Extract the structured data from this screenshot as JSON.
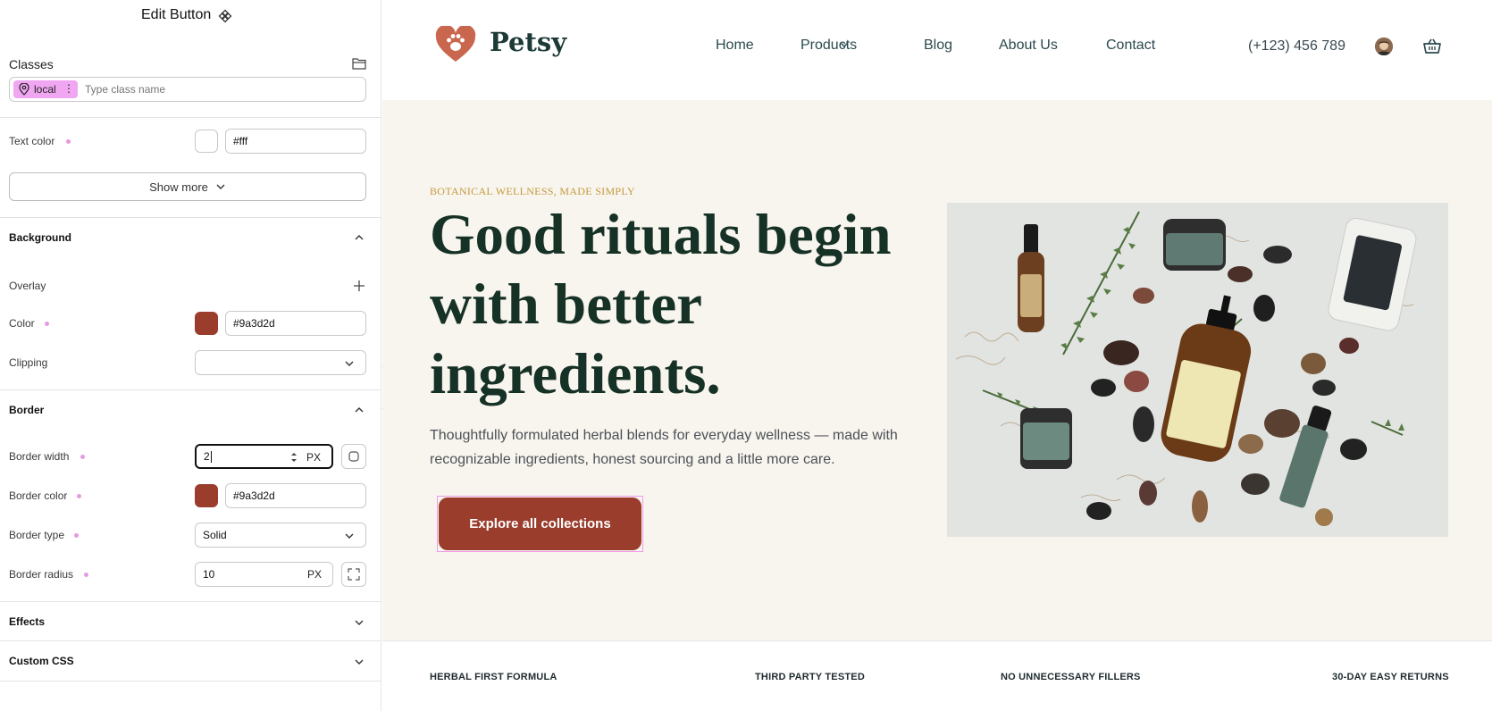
{
  "editor": {
    "title": "Edit Button",
    "classes": {
      "label": "Classes",
      "chip": "local",
      "placeholder": "Type class name"
    },
    "text_color": {
      "label": "Text color",
      "value": "#fff",
      "swatch": "#ffffff"
    },
    "show_more": "Show more",
    "background": {
      "title": "Background",
      "overlay_label": "Overlay",
      "color_label": "Color",
      "color_value": "#9a3d2d",
      "swatch": "#9a3d2d",
      "clipping_label": "Clipping",
      "clipping_value": ""
    },
    "border": {
      "title": "Border",
      "width_label": "Border width",
      "width_value": "2",
      "width_unit": "PX",
      "color_label": "Border color",
      "color_value": "#9a3d2d",
      "swatch": "#9a3d2d",
      "type_label": "Border type",
      "type_value": "Solid",
      "radius_label": "Border radius",
      "radius_value": "10",
      "radius_unit": "PX"
    },
    "effects_title": "Effects",
    "custom_css_title": "Custom CSS"
  },
  "site": {
    "logo": "Petsy",
    "nav": [
      "Home",
      "Products",
      "Blog",
      "About Us",
      "Contact"
    ],
    "phone": "(+123) 456 789",
    "hero": {
      "eyebrow": "BOTANICAL WELLNESS, MADE SIMPLY",
      "headline": "Good rituals begin with better ingredients.",
      "sub": "Thoughtfully formulated herbal blends for everyday wellness — made with recognizable ingredients, honest sourcing and a little more care.",
      "cta": "Explore all collections"
    },
    "features": [
      "HERBAL FIRST FORMULA",
      "THIRD PARTY TESTED",
      "NO UNNECESSARY FILLERS",
      "30-DAY EASY RETURNS"
    ]
  },
  "colors": {
    "brand": "#9a3d2d",
    "heading": "#163126",
    "eyebrow": "#c49a3d",
    "hero_bg": "#f8f5ee",
    "chip": "#f0a6f1"
  }
}
